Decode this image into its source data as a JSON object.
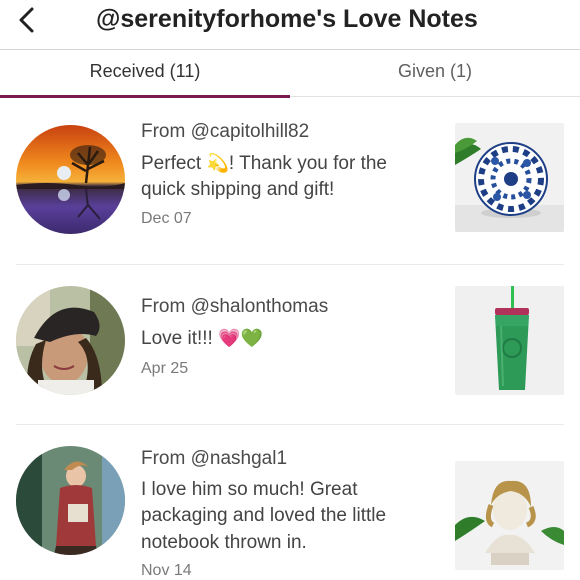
{
  "header": {
    "title": "@serenityforhome's Love Notes",
    "back_icon": "chevron-left-icon"
  },
  "tabs": [
    {
      "label": "Received (11)",
      "active": true
    },
    {
      "label": "Given (1)",
      "active": false
    }
  ],
  "accent_color": "#7a1b4f",
  "notes": [
    {
      "from": "From @capitolhill82",
      "message_pre": "Perfect ",
      "emoji": "💫",
      "message_post": "! Thank you for the quick shipping and gift!",
      "date": "Dec 07"
    },
    {
      "from": "From @shalonthomas",
      "message_pre": "Love it!!! ",
      "emoji": "💗💚",
      "message_post": "",
      "date": "Apr 25"
    },
    {
      "from": "From @nashgal1",
      "message_pre": "I love him so much! Great packaging and loved the little notebook thrown in.",
      "emoji": "",
      "message_post": "",
      "date": "Nov 14"
    }
  ]
}
